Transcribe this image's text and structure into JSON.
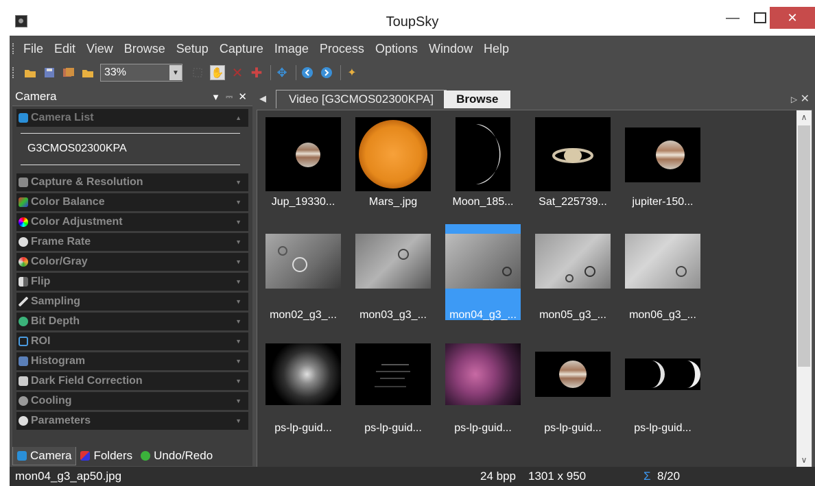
{
  "window": {
    "title": "ToupSky"
  },
  "menu": [
    "File",
    "Edit",
    "View",
    "Browse",
    "Setup",
    "Capture",
    "Image",
    "Process",
    "Options",
    "Window",
    "Help"
  ],
  "toolbar": {
    "zoom": "33%"
  },
  "left_panel": {
    "title": "Camera",
    "sections": [
      "Camera List",
      "Capture & Resolution",
      "Color Balance",
      "Color Adjustment",
      "Frame Rate",
      "Color/Gray",
      "Flip",
      "Sampling",
      "Bit Depth",
      "ROI",
      "Histogram",
      "Dark Field Correction",
      "Cooling",
      "Parameters"
    ],
    "camera_name": "G3CMOS02300KPA",
    "bottom_tabs": [
      "Camera",
      "Folders",
      "Undo/Redo"
    ]
  },
  "tabs": [
    "Video [G3CMOS02300KPA]",
    "Browse"
  ],
  "gallery": {
    "items": [
      "Jup_19330...",
      "Mars_.jpg",
      "Moon_185...",
      "Sat_225739...",
      "jupiter-150...",
      "mon02_g3_...",
      "mon03_g3_...",
      "mon04_g3_...",
      "mon05_g3_...",
      "mon06_g3_...",
      "ps-lp-guid...",
      "ps-lp-guid...",
      "ps-lp-guid...",
      "ps-lp-guid...",
      "ps-lp-guid..."
    ]
  },
  "status": {
    "filename": "mon04_g3_ap50.jpg",
    "bpp": "24 bpp",
    "dims": "1301 x 950",
    "count": "8/20"
  },
  "colors": {
    "accent": "#3d9af5",
    "close": "#c74b4b",
    "panel": "#4b4b4b"
  }
}
